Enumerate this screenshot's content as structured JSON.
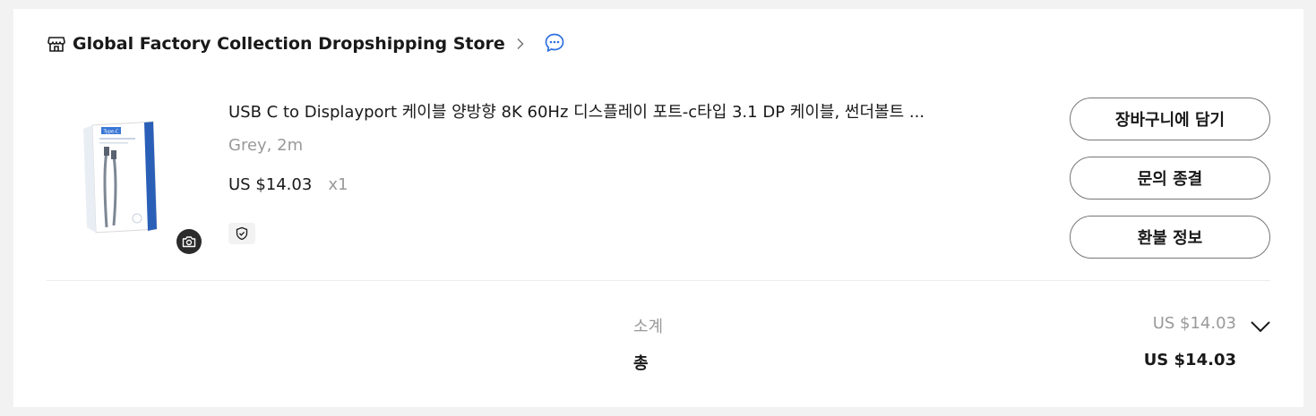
{
  "store": {
    "name": "Global Factory Collection Dropshipping Store",
    "icon": "store-icon",
    "chevron_icon": "chevron-right-icon",
    "chat_icon": "chat-bubble-icon"
  },
  "item": {
    "title": "USB C to Displayport 케이블 양방향 8K 60Hz 디스플레이 포트-c타입 3.1 DP 케이블, 썬더볼트 ...",
    "variant": "Grey, 2m",
    "price": "US $14.03",
    "quantity": "x1",
    "image_icon": "product-thumbnail",
    "camera_icon": "camera-icon",
    "protection_icon": "shield-check-icon",
    "thumbnail_text": "Type-C"
  },
  "actions": {
    "add_to_cart": "장바구니에 담기",
    "close_inquiry": "문의 종결",
    "refund_info": "환불 정보"
  },
  "summary": {
    "subtotal_label": "소계",
    "subtotal_value": "US $14.03",
    "total_label": "총",
    "total_value": "US $14.03",
    "expand_icon": "chevron-down-icon"
  },
  "colors": {
    "accent_blue": "#2f6fe0",
    "text_primary": "#191919",
    "text_secondary": "#999999",
    "border": "#767676"
  }
}
